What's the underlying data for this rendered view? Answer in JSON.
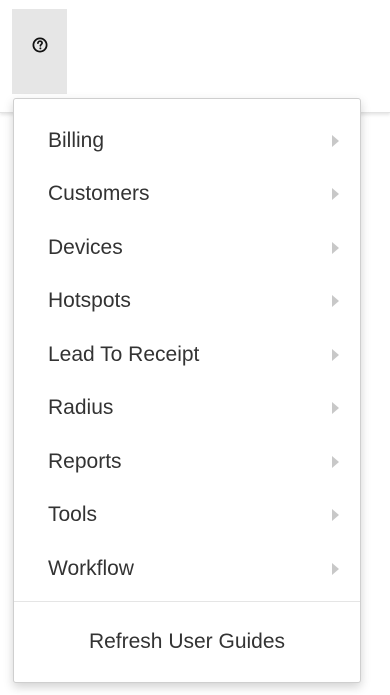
{
  "header": {
    "help_icon": "question-circle-icon"
  },
  "menu": {
    "items": [
      {
        "label": "Billing",
        "icon": "chevron-right-icon"
      },
      {
        "label": "Customers",
        "icon": "chevron-right-icon"
      },
      {
        "label": "Devices",
        "icon": "chevron-right-icon"
      },
      {
        "label": "Hotspots",
        "icon": "chevron-right-icon"
      },
      {
        "label": "Lead To Receipt",
        "icon": "chevron-right-icon"
      },
      {
        "label": "Radius",
        "icon": "chevron-right-icon"
      },
      {
        "label": "Reports",
        "icon": "chevron-right-icon"
      },
      {
        "label": "Tools",
        "icon": "chevron-right-icon"
      },
      {
        "label": "Workflow",
        "icon": "chevron-right-icon"
      }
    ],
    "footer_label": "Refresh User Guides"
  },
  "colors": {
    "text": "#333333",
    "chevron": "#c8c8c8",
    "help_tab_bg": "#e6e6e6",
    "menu_border": "#cfcfcf"
  }
}
